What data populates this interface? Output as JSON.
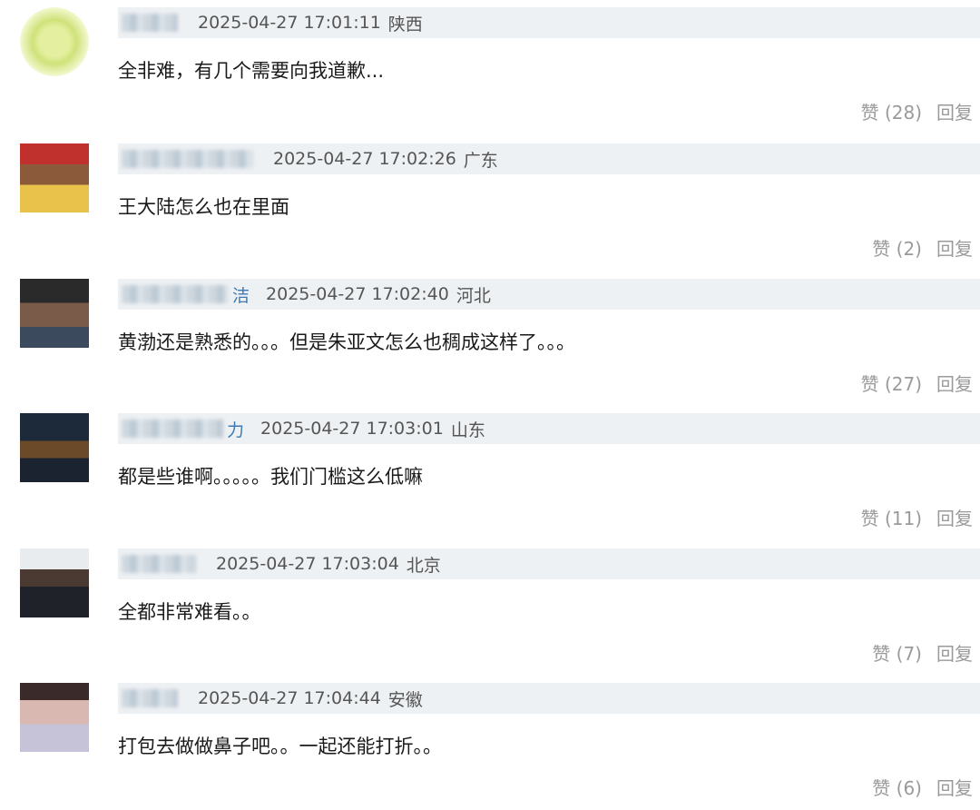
{
  "like_label": "赞",
  "reply_label": "回复",
  "comments": [
    {
      "name_tail": "",
      "time": "2025-04-27 17:01:11",
      "region": "陕西",
      "text": "全非难，有几个需要向我道歉...",
      "likes": "(28)"
    },
    {
      "name_tail": "",
      "time": "2025-04-27 17:02:26",
      "region": "广东",
      "text": "王大陆怎么也在里面",
      "likes": "(2)"
    },
    {
      "name_tail": "洁",
      "time": "2025-04-27 17:02:40",
      "region": "河北",
      "text": "黄渤还是熟悉的。。。但是朱亚文怎么也稠成这样了。。。",
      "likes": "(27)"
    },
    {
      "name_tail": "力",
      "time": "2025-04-27 17:03:01",
      "region": "山东",
      "text": "都是些谁啊。。。。。我们门槛这么低嘛",
      "likes": "(11)"
    },
    {
      "name_tail": "",
      "time": "2025-04-27 17:03:04",
      "region": "北京",
      "text": "全都非常难看。。",
      "likes": "(7)"
    },
    {
      "name_tail": "",
      "time": "2025-04-27 17:04:44",
      "region": "安徽",
      "text": "打包去做做鼻子吧。。一起还能打折。。",
      "likes": "(6)"
    }
  ]
}
